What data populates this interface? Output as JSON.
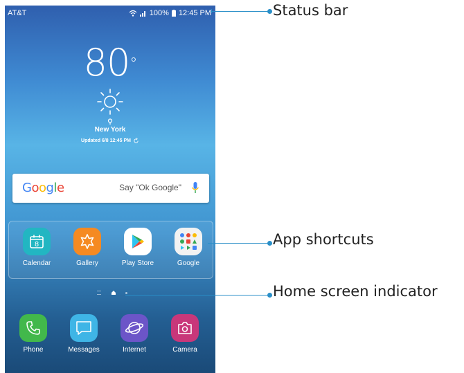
{
  "status_bar": {
    "carrier": "AT&T",
    "battery": "100%",
    "time": "12:45 PM"
  },
  "weather": {
    "temperature": "80",
    "degree_symbol": "°",
    "city": "New York",
    "updated": "Updated 6/8 12:45 PM"
  },
  "search": {
    "logo": "Google",
    "hint": "Say \"Ok Google\""
  },
  "apps": [
    {
      "label": "Calendar",
      "icon": "calendar-icon",
      "color": "#22b6c2",
      "date": "8"
    },
    {
      "label": "Gallery",
      "icon": "gallery-icon",
      "color": "#f58a22"
    },
    {
      "label": "Play Store",
      "icon": "play-store-icon",
      "color": "#ffffff"
    },
    {
      "label": "Google",
      "icon": "google-folder-icon",
      "color": "#f2f2f2"
    }
  ],
  "dock": [
    {
      "label": "Phone",
      "icon": "phone-icon",
      "color": "#42b84b"
    },
    {
      "label": "Messages",
      "icon": "messages-icon",
      "color": "#3fb5e6"
    },
    {
      "label": "Internet",
      "icon": "internet-icon",
      "color": "#6c55c8"
    },
    {
      "label": "Camera",
      "icon": "camera-icon",
      "color": "#c8377a"
    }
  ],
  "callouts": {
    "status_bar": "Status bar",
    "app_shortcuts": "App shortcuts",
    "home_indicator": "Home screen indicator"
  },
  "colors": {
    "callout": "#2a8fc8",
    "google_blue": "#4285f4",
    "google_red": "#ea4335",
    "google_yellow": "#fbbc05",
    "google_green": "#34a853"
  }
}
